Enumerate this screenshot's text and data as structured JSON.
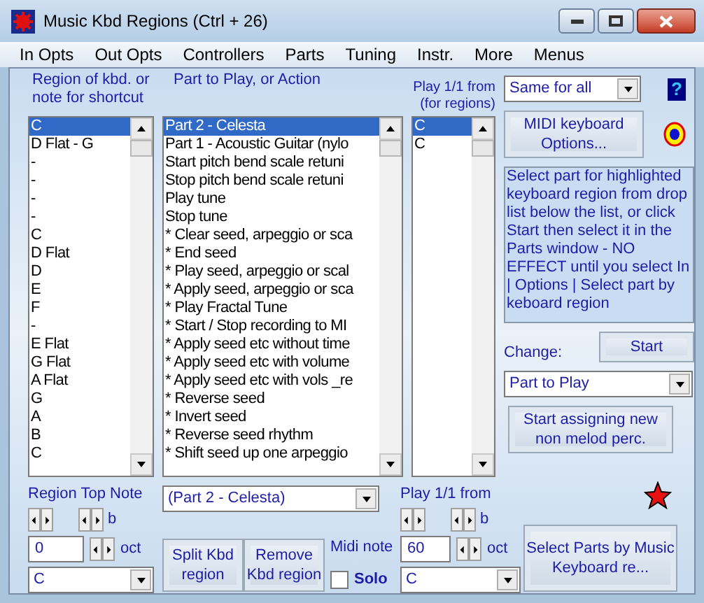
{
  "window": {
    "title": "Music Kbd Regions (Ctrl + 26)"
  },
  "menu": [
    "In Opts",
    "Out Opts",
    "Controllers",
    "Parts",
    "Tuning",
    "Instr.",
    "More",
    "Menus"
  ],
  "headers": {
    "region": "Region of kbd. or note for shortcut",
    "part": "Part to Play, or Action",
    "play_from": "Play 1/1 from (for regions)"
  },
  "same_for_all": {
    "value": "Same for all"
  },
  "help": "?",
  "region_list": [
    {
      "text": "C",
      "selected": true
    },
    {
      "text": "D Flat - G",
      "selected": false
    },
    {
      "text": "-",
      "selected": false
    },
    {
      "text": "-",
      "selected": false
    },
    {
      "text": "-",
      "selected": false
    },
    {
      "text": "-",
      "selected": false
    },
    {
      "text": "C",
      "selected": false
    },
    {
      "text": "D Flat",
      "selected": false
    },
    {
      "text": "D",
      "selected": false
    },
    {
      "text": "E",
      "selected": false
    },
    {
      "text": "F",
      "selected": false
    },
    {
      "text": "-",
      "selected": false
    },
    {
      "text": "E Flat",
      "selected": false
    },
    {
      "text": "G Flat",
      "selected": false
    },
    {
      "text": "A Flat",
      "selected": false
    },
    {
      "text": "G",
      "selected": false
    },
    {
      "text": "A",
      "selected": false
    },
    {
      "text": "B",
      "selected": false
    },
    {
      "text": "C",
      "selected": false
    }
  ],
  "part_list": [
    {
      "text": "Part 2 - Celesta",
      "selected": true
    },
    {
      "text": "Part 1 - Acoustic Guitar (nylo",
      "selected": false
    },
    {
      "text": "Start pitch bend scale retuni",
      "selected": false
    },
    {
      "text": "Stop pitch bend scale retuni",
      "selected": false
    },
    {
      "text": "Play tune",
      "selected": false
    },
    {
      "text": "Stop tune",
      "selected": false
    },
    {
      "text": "* Clear seed, arpeggio or sca",
      "selected": false
    },
    {
      "text": "* End seed",
      "selected": false
    },
    {
      "text": "* Play seed, arpeggio or scal",
      "selected": false
    },
    {
      "text": "* Apply seed, arpeggio or sca",
      "selected": false
    },
    {
      "text": "* Play Fractal Tune",
      "selected": false
    },
    {
      "text": "* Start / Stop recording to MI",
      "selected": false
    },
    {
      "text": "* Apply seed etc without time",
      "selected": false
    },
    {
      "text": "* Apply seed etc with volume",
      "selected": false
    },
    {
      "text": "* Apply seed etc with vols _re",
      "selected": false
    },
    {
      "text": "* Reverse seed",
      "selected": false
    },
    {
      "text": "* Invert seed",
      "selected": false
    },
    {
      "text": "* Reverse seed rhythm",
      "selected": false
    },
    {
      "text": "* Shift seed up one arpeggio",
      "selected": false
    }
  ],
  "play_list": [
    {
      "text": "C",
      "selected": true
    },
    {
      "text": "C",
      "selected": false
    }
  ],
  "midi_options_button": "MIDI keyboard Options...",
  "info": "Select part for highlighted keyboard region from drop list below the list, or click Start then select it in the Parts window - NO EFFECT until you select In | Options | Select part by keboard region",
  "change_label": "Change:",
  "start_button": "Start",
  "change_combo": {
    "value": "Part to Play"
  },
  "perc_button": "Start assigning new non melod perc.",
  "region_top_note": {
    "label": "Region Top Note",
    "b": "b",
    "value": "0",
    "oct": "oct",
    "note": "C"
  },
  "part_combo": {
    "value": "(Part 2 - Celesta)"
  },
  "split_button": "Split Kbd region",
  "remove_button": "Remove Kbd region",
  "midi_note_label": "Midi note",
  "solo": {
    "label": "Solo",
    "checked": false
  },
  "play_from": {
    "label": "Play 1/1 from",
    "b": "b",
    "value": "60",
    "oct": "oct",
    "note": "C"
  },
  "select_parts_button": "Select Parts by Music Keyboard re..."
}
